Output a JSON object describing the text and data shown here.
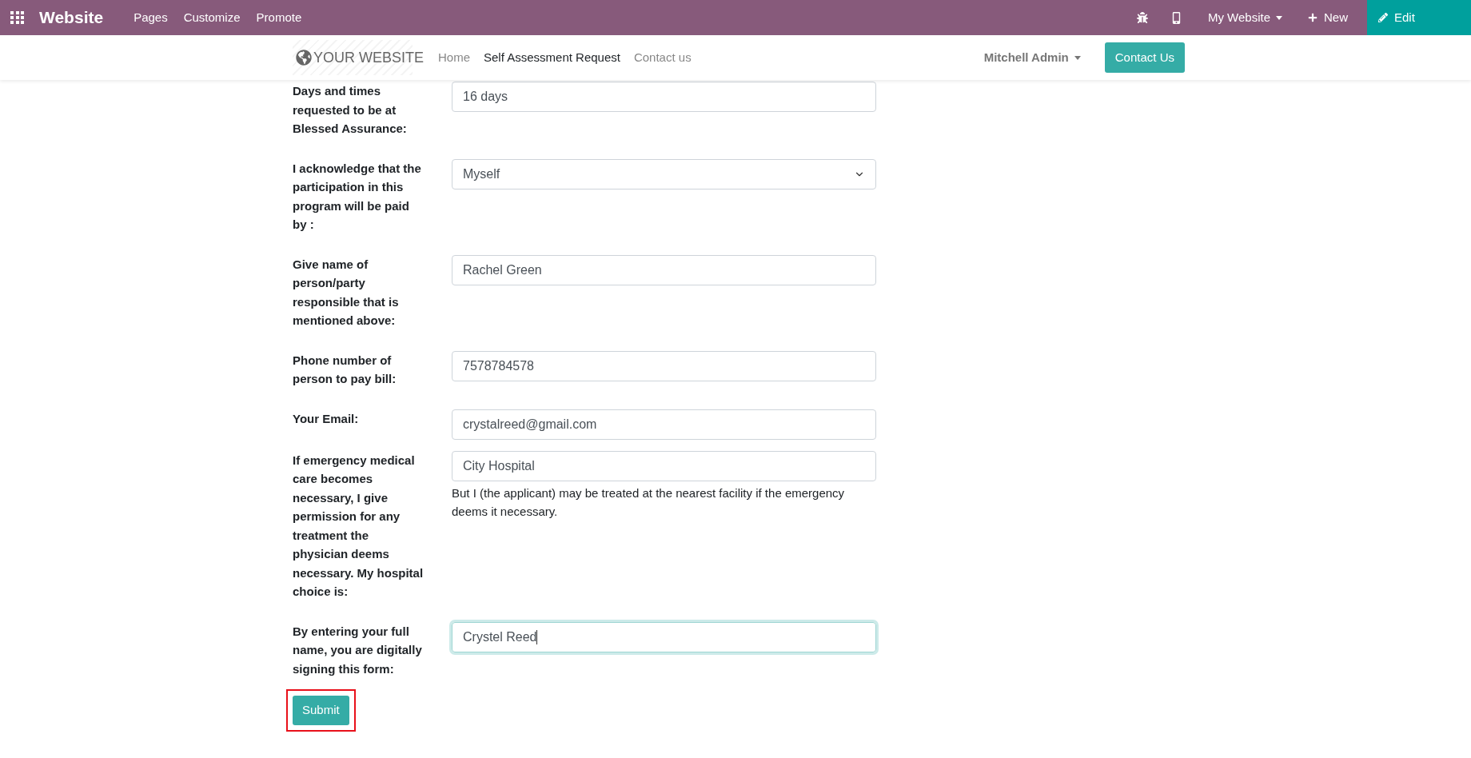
{
  "topbar": {
    "app_name": "Website",
    "menu": [
      "Pages",
      "Customize",
      "Promote"
    ],
    "website_switcher": "My Website",
    "new_button": "New",
    "edit_button": "Edit"
  },
  "site_header": {
    "logo_text": "YOUR WEBSITE",
    "nav": [
      {
        "label": "Home",
        "selected": false
      },
      {
        "label": "Self Assessment Request",
        "selected": true
      },
      {
        "label": "Contact us",
        "selected": false
      }
    ],
    "user": "Mitchell Admin",
    "cta": "Contact Us"
  },
  "form": {
    "fields": [
      {
        "kind": "text",
        "label": "Days and times requested to be at Blessed Assurance:",
        "value": "16 days",
        "focused": false
      },
      {
        "kind": "select",
        "label": "I acknowledge that the participation in this program will be paid by :",
        "value": "Myself",
        "focused": false
      },
      {
        "kind": "text",
        "label": "Give name of person/party responsible that is mentioned above:",
        "value": "Rachel Green",
        "focused": false
      },
      {
        "kind": "text",
        "label": "Phone number of person to pay bill:",
        "value": "7578784578",
        "focused": false
      },
      {
        "kind": "text",
        "label": "Your Email:",
        "value": "crystalreed@gmail.com",
        "focused": false
      },
      {
        "kind": "text",
        "label": "If emergency medical care becomes necessary, I give permission for any treatment the physician deems necessary. My hospital choice is:",
        "value": "City Hospital",
        "help": "But I (the applicant) may be treated at the nearest facility if the emergency deems it necessary.",
        "focused": false
      },
      {
        "kind": "text",
        "label": "By entering your full name, you are digitally signing this form:",
        "value": "Crystel Reed",
        "focused": true
      }
    ],
    "submit": {
      "label": "Submit",
      "highlighted": true
    }
  }
}
